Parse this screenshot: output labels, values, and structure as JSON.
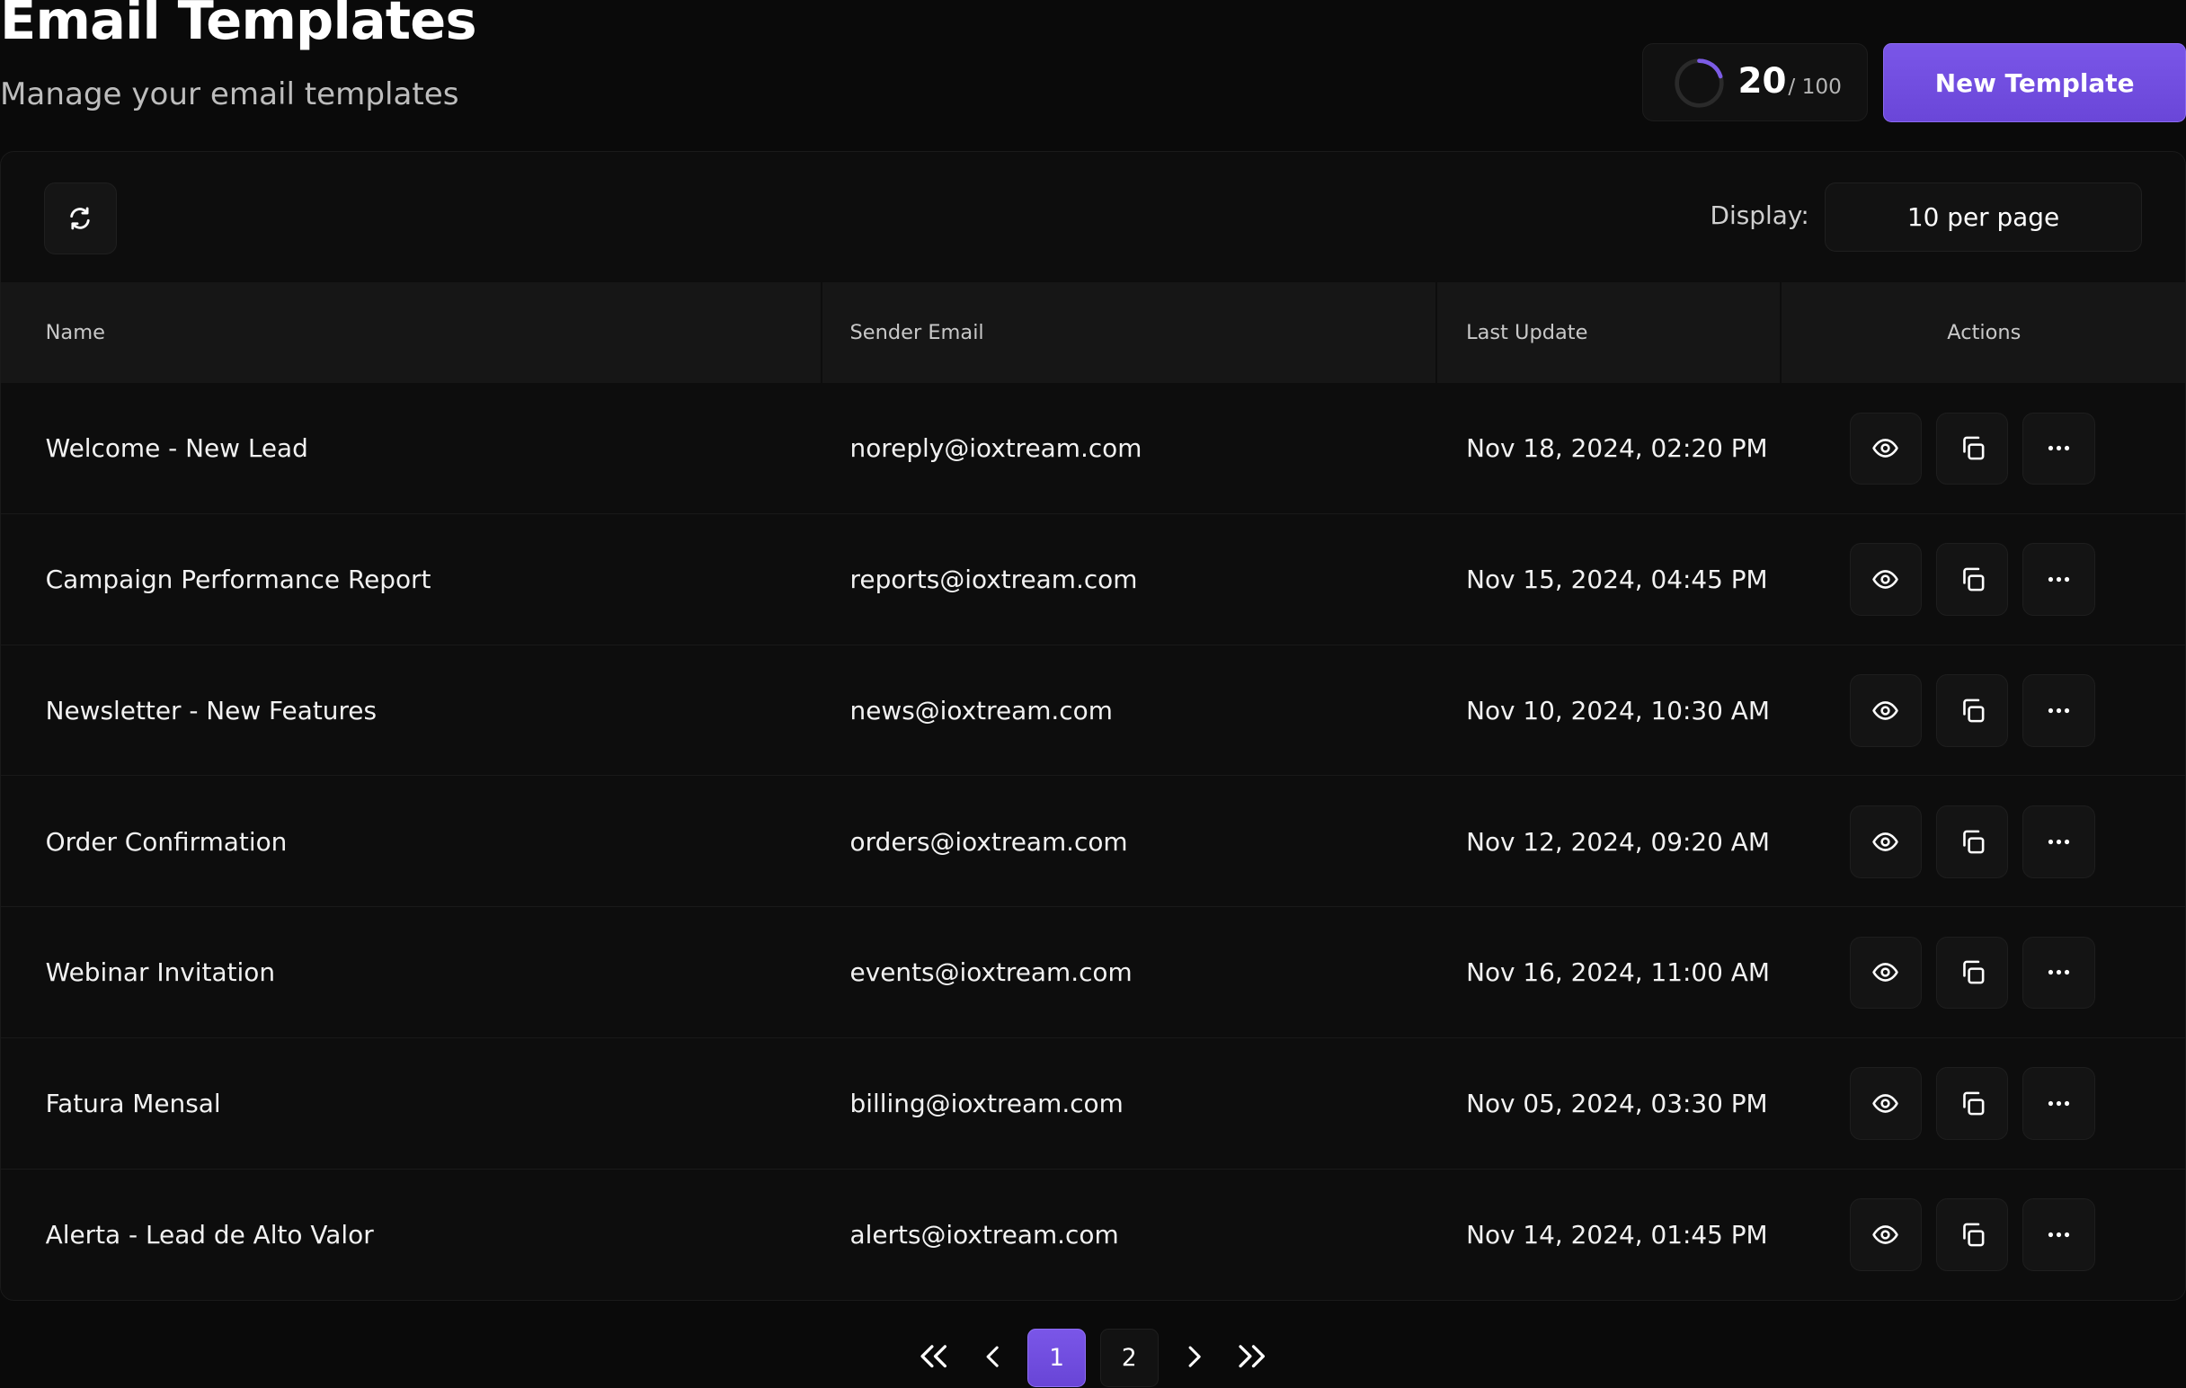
{
  "header": {
    "title": "Email Templates",
    "subtitle": "Manage your email templates",
    "quota": {
      "used": "20",
      "total": "/ 100",
      "fraction": 0.2,
      "icon": "progress-ring-icon",
      "accent": "#7c5ce6"
    },
    "new_button_label": "New Template"
  },
  "toolbar": {
    "refresh_icon": "refresh-icon",
    "display_label": "Display:",
    "per_page_value": "10 per page"
  },
  "table": {
    "columns": [
      "Name",
      "Sender Email",
      "Last Update",
      "Actions"
    ],
    "rows": [
      {
        "name": "Welcome - New Lead",
        "sender": "noreply@ioxtream.com",
        "updated": "Nov 18, 2024, 02:20 PM"
      },
      {
        "name": "Campaign Performance Report",
        "sender": "reports@ioxtream.com",
        "updated": "Nov 15, 2024, 04:45 PM"
      },
      {
        "name": "Newsletter - New Features",
        "sender": "news@ioxtream.com",
        "updated": "Nov 10, 2024, 10:30 AM"
      },
      {
        "name": "Order Confirmation",
        "sender": "orders@ioxtream.com",
        "updated": "Nov 12, 2024, 09:20 AM"
      },
      {
        "name": "Webinar Invitation",
        "sender": "events@ioxtream.com",
        "updated": "Nov 16, 2024, 11:00 AM"
      },
      {
        "name": "Fatura Mensal",
        "sender": "billing@ioxtream.com",
        "updated": "Nov 05, 2024, 03:30 PM"
      },
      {
        "name": "Alerta - Lead de Alto Valor",
        "sender": "alerts@ioxtream.com",
        "updated": "Nov 14, 2024, 01:45 PM"
      }
    ],
    "action_icons": [
      "eye-icon",
      "copy-icon",
      "more-icon"
    ]
  },
  "pagination": {
    "pages": [
      "1",
      "2"
    ],
    "current": "1",
    "icons": [
      "double-chevron-left-icon",
      "chevron-left-icon",
      "chevron-right-icon",
      "double-chevron-right-icon"
    ]
  },
  "colors": {
    "background": "#0a0a0a",
    "accent": "#7a56e8",
    "table_header": "#161616"
  }
}
